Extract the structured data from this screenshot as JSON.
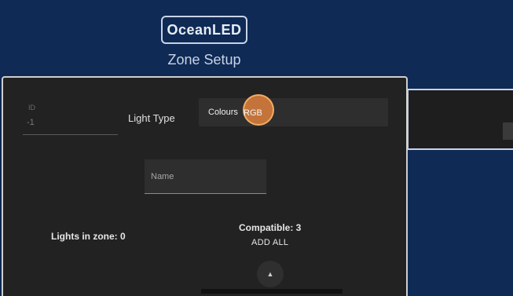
{
  "header": {
    "logo_text": "OceanLED",
    "title": "Zone Setup"
  },
  "dialog": {
    "id_field": {
      "label": "ID",
      "value": "-1"
    },
    "light_type": {
      "label": "Light Type",
      "value_prefix": "Colours",
      "value_highlight": "RGB"
    },
    "name_field": {
      "placeholder": "Name"
    },
    "lights_in_zone": "Lights in zone: 0",
    "compatible": "Compatible: 3",
    "add_all": "ADD ALL",
    "scroll_up_icon": "▲"
  },
  "colors": {
    "background": "#0f2a55",
    "dialog": "#222222",
    "accent_ripple": "#de803c"
  }
}
